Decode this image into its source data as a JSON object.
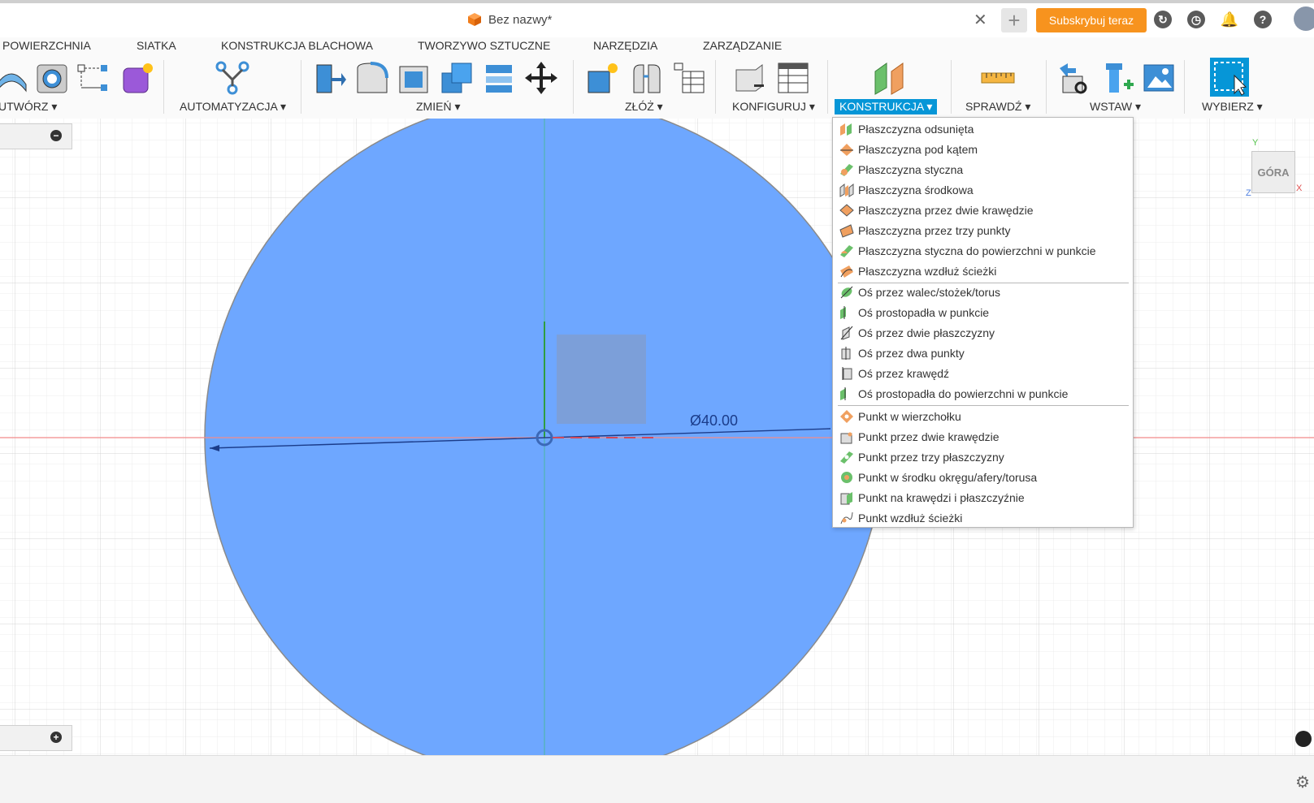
{
  "titlebar": {
    "doc_title": "Bez nazwy*",
    "subscribe_label": "Subskrybuj teraz",
    "close_glyph": "✕",
    "plus_glyph": "+"
  },
  "ribbon_tabs": [
    "POWIERZCHNIA",
    "SIATKA",
    "KONSTRUKCJA BLACHOWA",
    "TWORZYWO SZTUCZNE",
    "NARZĘDZIA",
    "ZARZĄDZANIE"
  ],
  "toolbar_groups": {
    "create": "UTWÓRZ ▾",
    "automate": "AUTOMATYZACJA ▾",
    "modify": "ZMIEŃ ▾",
    "assemble": "ZŁÓŻ ▾",
    "configure": "KONFIGURUJ ▾",
    "construct": "KONSTRUKCJA ▾",
    "inspect": "SPRAWDŹ ▾",
    "insert": "WSTAW ▾",
    "select": "WYBIERZ ▾"
  },
  "canvas": {
    "dimension_label": "Ø40.00",
    "viewcube_label": "GÓRA",
    "axis_y": "Y",
    "axis_x": "X",
    "axis_z": "Z",
    "circle_color": "#6ea7ff",
    "panel_minus": "−",
    "panel_plus": "+"
  },
  "construction_menu": {
    "planes": [
      {
        "label": "Płaszczyzna odsunięta",
        "icon": "offset-plane-icon"
      },
      {
        "label": "Płaszczyzna pod kątem",
        "icon": "angled-plane-icon"
      },
      {
        "label": "Płaszczyzna styczna",
        "icon": "tangent-plane-icon"
      },
      {
        "label": "Płaszczyzna środkowa",
        "icon": "midplane-icon"
      },
      {
        "label": "Płaszczyzna przez dwie krawędzie",
        "icon": "plane-two-edges-icon"
      },
      {
        "label": "Płaszczyzna przez trzy punkty",
        "icon": "plane-three-points-icon"
      },
      {
        "label": "Płaszczyzna styczna do powierzchni w punkcie",
        "icon": "plane-tangent-face-point-icon"
      },
      {
        "label": "Płaszczyzna wzdłuż ścieżki",
        "icon": "plane-along-path-icon"
      }
    ],
    "axes": [
      {
        "label": "Oś przez walec/stożek/torus",
        "icon": "axis-cylinder-icon"
      },
      {
        "label": "Oś prostopadła w punkcie",
        "icon": "axis-perpendicular-point-icon"
      },
      {
        "label": "Oś przez dwie płaszczyzny",
        "icon": "axis-two-planes-icon"
      },
      {
        "label": "Oś przez dwa punkty",
        "icon": "axis-two-points-icon"
      },
      {
        "label": "Oś przez krawędź",
        "icon": "axis-edge-icon"
      },
      {
        "label": "Oś prostopadła do powierzchni w punkcie",
        "icon": "axis-perpendicular-face-icon"
      }
    ],
    "points": [
      {
        "label": "Punkt w wierzchołku",
        "icon": "point-vertex-icon"
      },
      {
        "label": "Punkt przez dwie krawędzie",
        "icon": "point-two-edges-icon"
      },
      {
        "label": "Punkt przez trzy płaszczyzny",
        "icon": "point-three-planes-icon"
      },
      {
        "label": "Punkt w środku okręgu/afery/torusa",
        "icon": "point-center-icon"
      },
      {
        "label": "Punkt na krawędzi i płaszczyźnie",
        "icon": "point-edge-plane-icon"
      },
      {
        "label": "Punkt wzdłuż ścieżki",
        "icon": "point-along-path-icon"
      }
    ]
  },
  "colors": {
    "accent": "#0696d7",
    "subscribe": "#f7931e",
    "plane_green": "#5cb85c",
    "plane_orange": "#f0a060"
  }
}
